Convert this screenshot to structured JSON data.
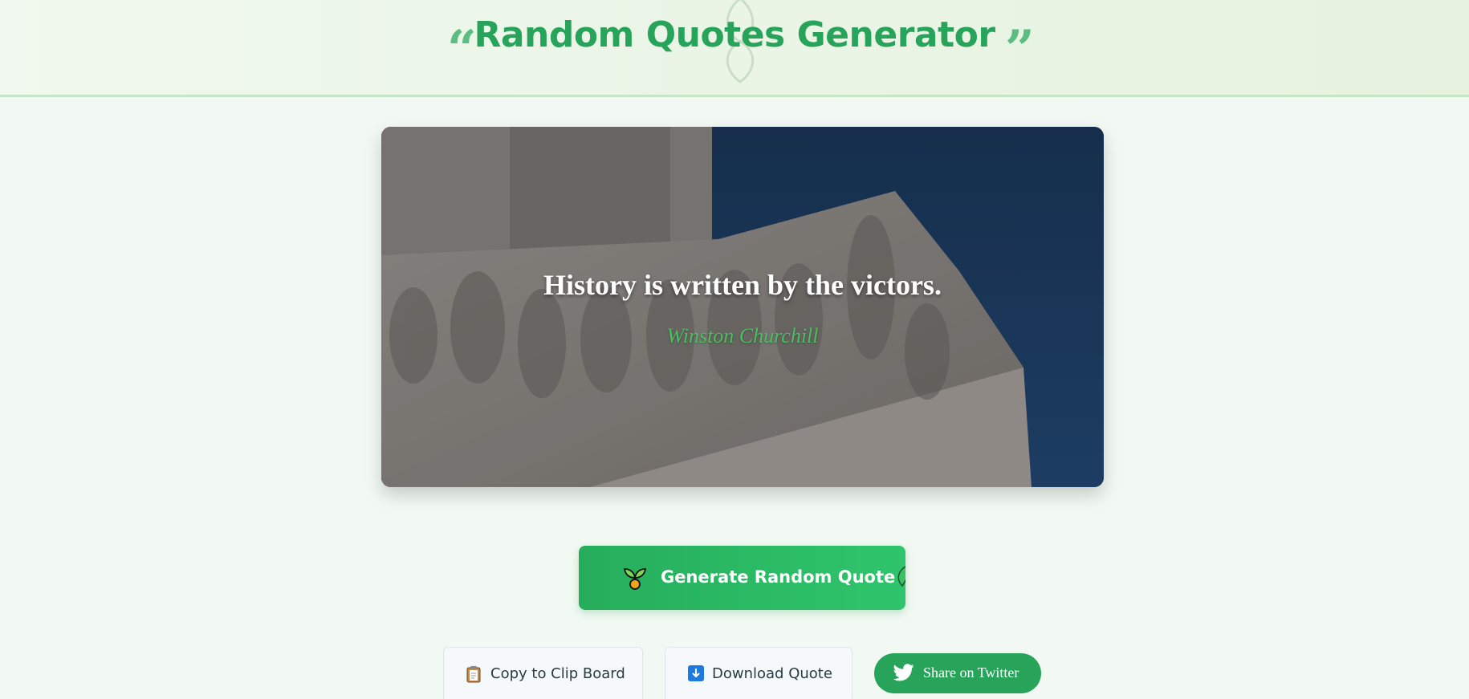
{
  "header": {
    "title": "Random Quotes Generator",
    "open_quote": "“",
    "close_quote": "”"
  },
  "quote": {
    "text": "History is written by the victors.",
    "author": "Winston Churchill",
    "background_image": "monument-relief-photo"
  },
  "actions": {
    "generate_label": "Generate Random Quote",
    "generate_icon": "sprout-icon",
    "copy_label": "Copy to Clip Board",
    "copy_icon": "clipboard-icon",
    "download_label": "Download Quote",
    "download_icon": "download-icon",
    "twitter_label": "Share on Twitter",
    "twitter_icon": "twitter-icon"
  },
  "colors": {
    "accent": "#27a35a",
    "button_gradient_start": "#26ad5c",
    "button_gradient_end": "#2fc56c",
    "author_color": "#4cbf62",
    "page_background": "#f2f9f2"
  }
}
